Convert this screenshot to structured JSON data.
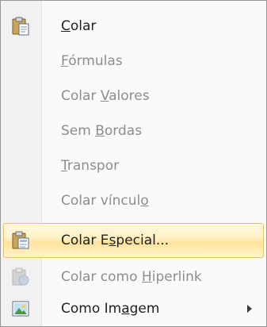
{
  "menu": {
    "items": [
      {
        "pre": "",
        "key": "C",
        "post": "olar",
        "icon": "paste-icon"
      },
      {
        "pre": "",
        "key": "F",
        "post": "órmulas"
      },
      {
        "pre": "Colar ",
        "key": "V",
        "post": "alores"
      },
      {
        "pre": "Sem ",
        "key": "B",
        "post": "ordas"
      },
      {
        "pre": "",
        "key": "T",
        "post": "ranspor"
      },
      {
        "pre": "Colar víncul",
        "key": "o",
        "post": ""
      },
      {
        "pre": "Colar E",
        "key": "s",
        "post": "pecial...",
        "icon": "paste-special-icon"
      },
      {
        "pre": "Colar como ",
        "key": "H",
        "post": "iperlink",
        "icon": "paste-hyperlink-icon"
      },
      {
        "pre": "Como Im",
        "key": "a",
        "post": "gem",
        "icon": "picture-icon"
      }
    ]
  },
  "colors": {
    "highlight_border": "#e5c365",
    "disabled_text": "#8d8d8d",
    "text": "#1f1f1f"
  }
}
